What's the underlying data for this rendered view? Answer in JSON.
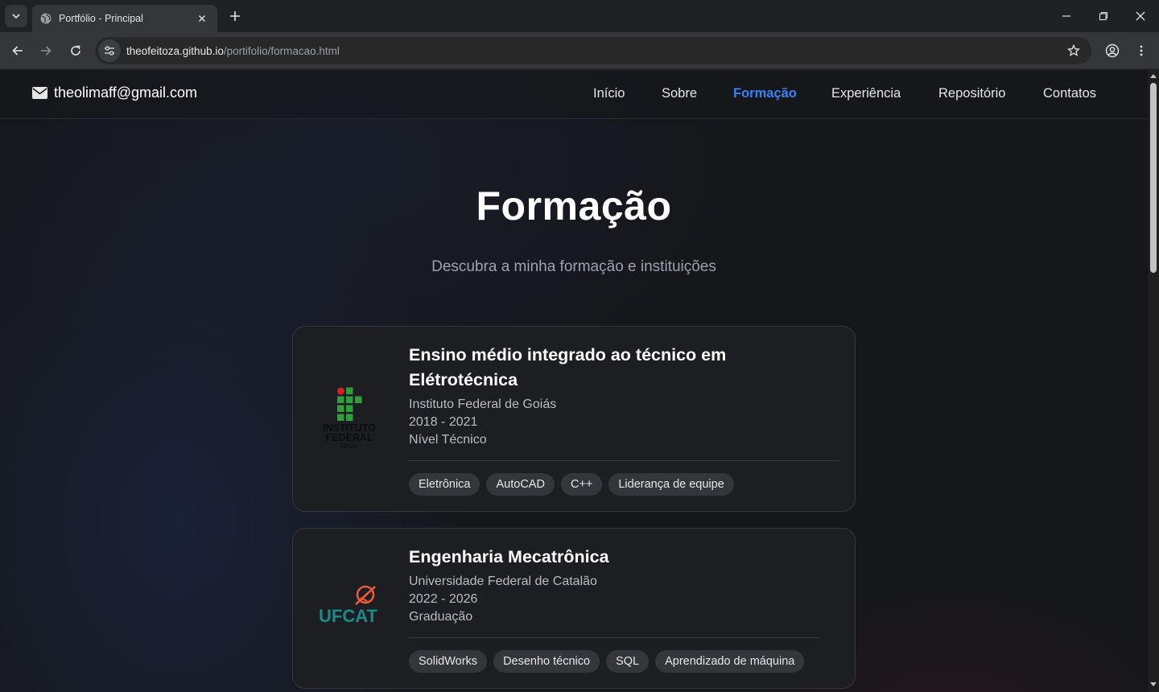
{
  "browser": {
    "tab_title": "Portfólio - Principal",
    "url_host": "theofeitoza.github.io",
    "url_path": "/portifolio/formacao.html"
  },
  "header": {
    "email": "theolimaff@gmail.com",
    "nav": [
      "Início",
      "Sobre",
      "Formação",
      "Experiência",
      "Repositório",
      "Contatos"
    ],
    "active_nav": "Formação",
    "accent_color": "#3b82f6"
  },
  "hero": {
    "title": "Formação",
    "subtitle": "Descubra a minha formação e instituições"
  },
  "education": [
    {
      "title": "Ensino médio integrado ao técnico em Elétrotécnica",
      "institution": "Instituto Federal de Goiás",
      "period": "2018 - 2021",
      "level": "Nível Técnico",
      "tags": [
        "Eletrônica",
        "AutoCAD",
        "C++",
        "Liderança de equipe"
      ],
      "logo": {
        "line1": "INSTITUTO",
        "line2": "FEDERAL",
        "line3": "Goiás"
      }
    },
    {
      "title": "Engenharia Mecatrônica",
      "institution": "Universidade Federal de Catalão",
      "period": "2022 - 2026",
      "level": "Graduação",
      "tags": [
        "SolidWorks",
        "Desenho técnico",
        "SQL",
        "Aprendizado de máquina"
      ],
      "logo": {
        "text": "UFCAT"
      }
    }
  ]
}
